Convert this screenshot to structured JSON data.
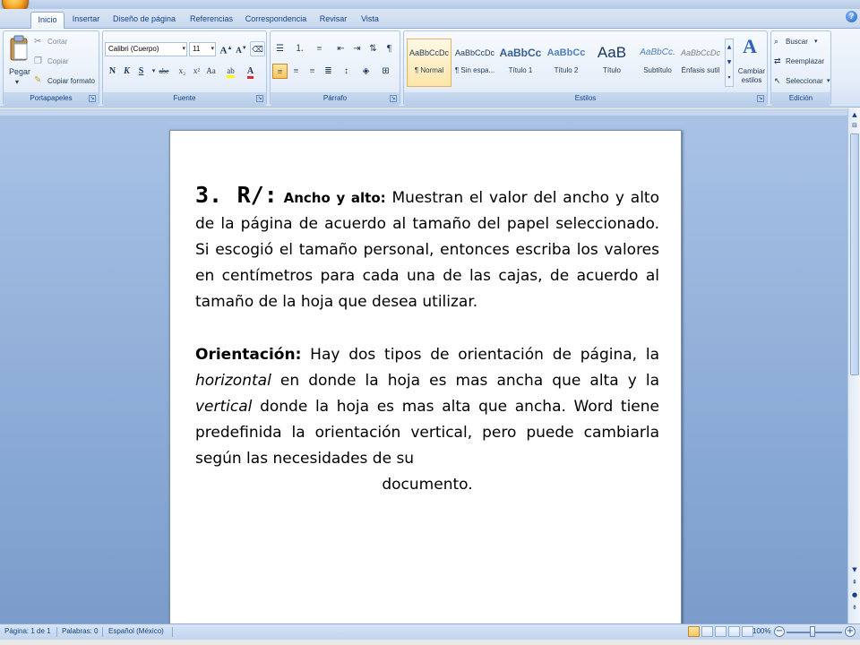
{
  "tabs": [
    "Inicio",
    "Insertar",
    "Diseño de página",
    "Referencias",
    "Correspondencia",
    "Revisar",
    "Vista"
  ],
  "clipboard": {
    "paste": "Pegar",
    "cut": "Cortar",
    "copy": "Copiar",
    "format_painter": "Copiar formato",
    "group_label": "Portapapeles"
  },
  "font": {
    "name": "Calibri (Cuerpo)",
    "size": "11",
    "group_label": "Fuente",
    "bold": "N",
    "italic": "K",
    "underline": "S",
    "strike": "abe",
    "subscript": "x₂",
    "superscript": "x²",
    "case": "Aa",
    "grow": "A",
    "shrink": "A"
  },
  "paragraph": {
    "group_label": "Párrafo"
  },
  "styles": {
    "group_label": "Estilos",
    "items": [
      {
        "sample": "AaBbCcDc",
        "name": "¶ Normal"
      },
      {
        "sample": "AaBbCcDc",
        "name": "¶ Sin espa..."
      },
      {
        "sample": "AaBbCc",
        "name": "Título 1"
      },
      {
        "sample": "AaBbCc",
        "name": "Título 2"
      },
      {
        "sample": "AaB",
        "name": "Título"
      },
      {
        "sample": "AaBbCc.",
        "name": "Subtítulo"
      },
      {
        "sample": "AaBbCcDc",
        "name": "Énfasis sutil"
      }
    ],
    "change_styles": "Cambiar estilos"
  },
  "editing": {
    "group_label": "Edición",
    "find": "Buscar",
    "replace": "Reemplazar",
    "select": "Seleccionar"
  },
  "document": {
    "p1_head": "3. R/:",
    "p1_label": "Ancho y alto:",
    "p1_body": "Muestran el valor del ancho y alto de la página de acuerdo al tamaño del papel seleccionado. Si escogió el tamaño personal, entonces escriba los valores en centímetros para cada una de las cajas, de acuerdo al tamaño de la hoja que desea utilizar.",
    "p2_label": "Orientación:",
    "p2_a": "Hay dos tipos de orientación de página, la",
    "p2_horizontal": "horizontal",
    "p2_b": "en donde la hoja es mas ancha que alta y la",
    "p2_vertical": "vertical",
    "p2_c": "donde la hoja es mas alta que ancha. Word tiene predefinida la orientación vertical, pero puede cambiarla según las necesidades de su",
    "p2_last": "documento."
  },
  "status": {
    "page": "Página: 1 de 1",
    "words": "Palabras: 0",
    "language": "Español (México)",
    "zoom": "100%"
  }
}
